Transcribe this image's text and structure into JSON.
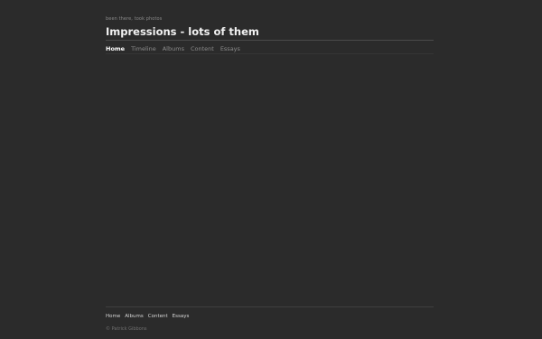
{
  "header": {
    "tagline": "been there, took photos",
    "title": "Impressions - lots of them"
  },
  "nav": {
    "items": [
      {
        "label": "Home"
      },
      {
        "label": "Timeline"
      },
      {
        "label": "Albums"
      },
      {
        "label": "Content"
      },
      {
        "label": "Essays"
      }
    ],
    "active": "Home"
  },
  "footer": {
    "links": [
      {
        "label": "Home"
      },
      {
        "label": "Albums"
      },
      {
        "label": "Content"
      },
      {
        "label": "Essays"
      }
    ],
    "copyright": "© Patrick Gibbons"
  },
  "colors": {
    "background": "#2b2b2b",
    "active_link": "#ffffff",
    "inactive_link": "#8c8c8c"
  }
}
